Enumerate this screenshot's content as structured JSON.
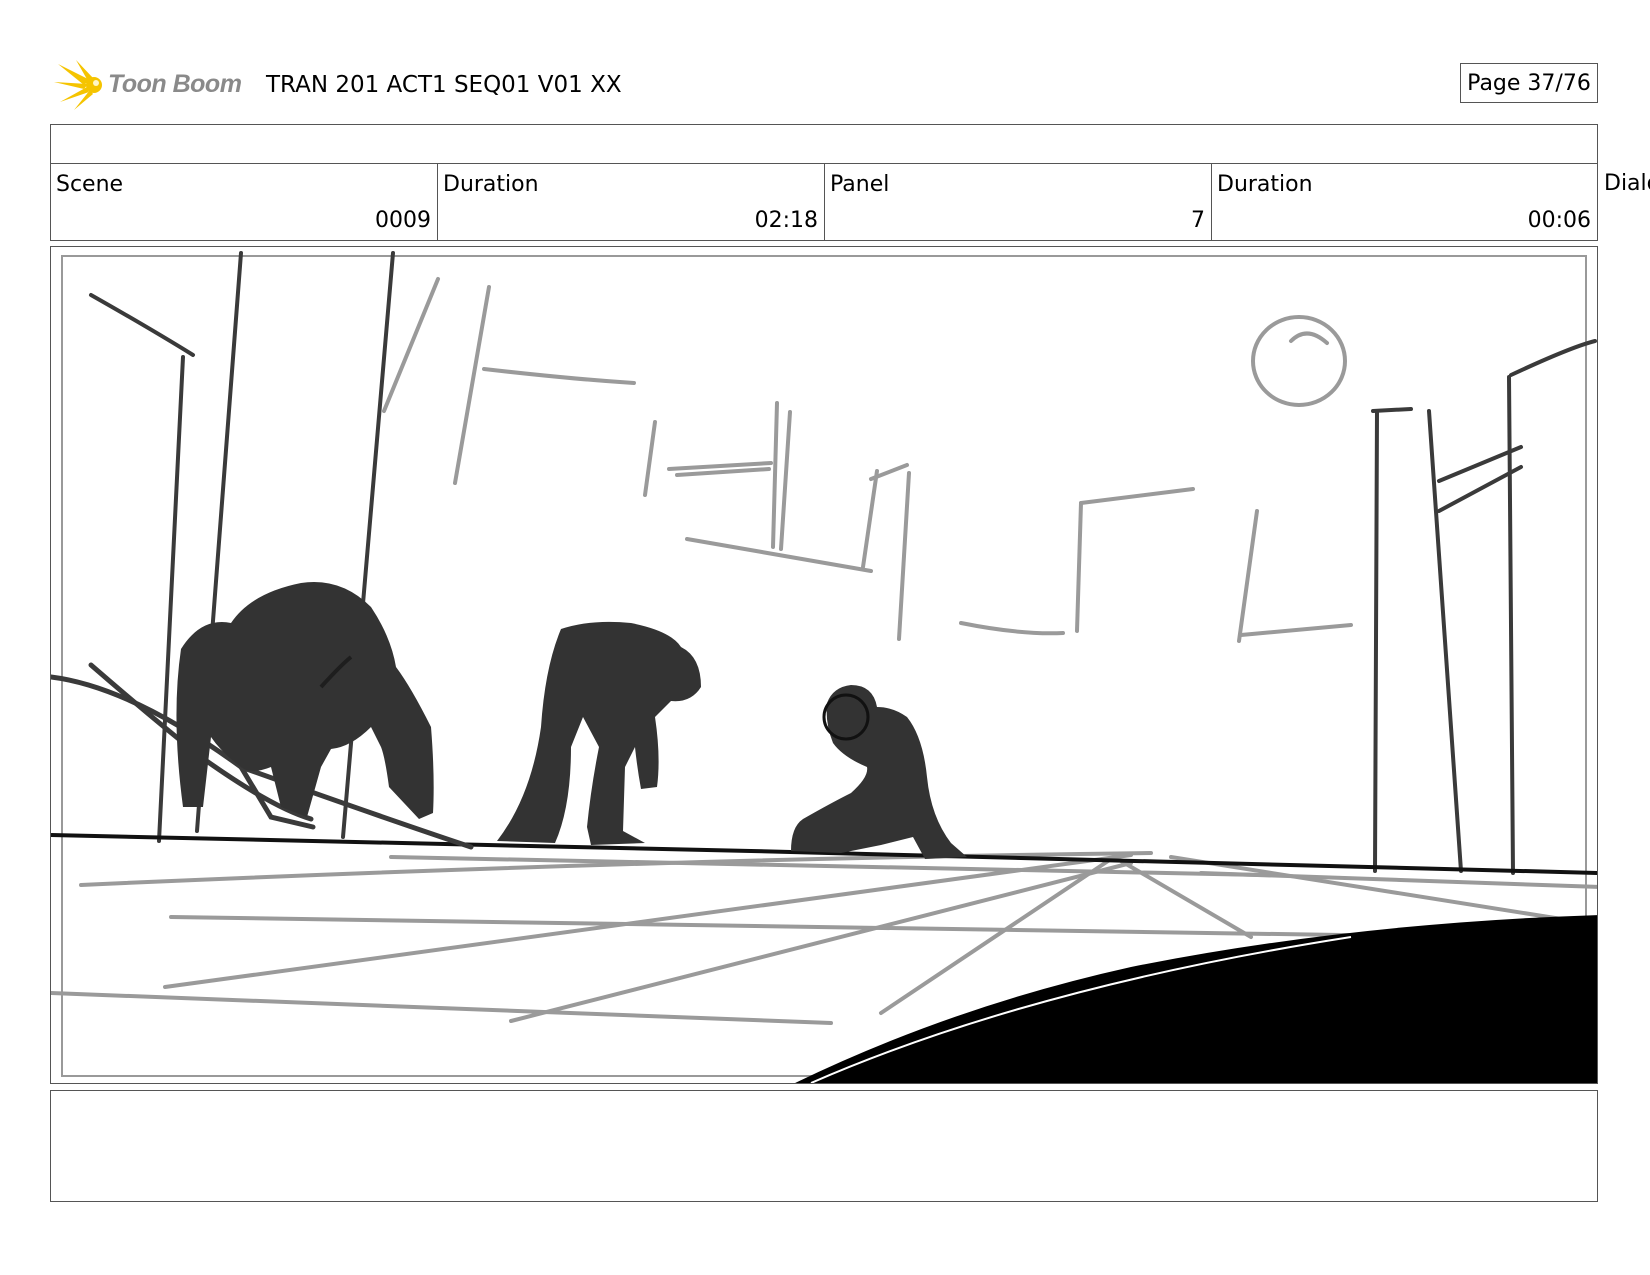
{
  "header": {
    "logo_text": "Toon Boom",
    "title": "TRAN 201 ACT1 SEQ01 V01 XX",
    "page": "Page 37/76"
  },
  "fields": {
    "scene_label": "Scene",
    "scene_value": "0009",
    "scene_duration_label": "Duration",
    "scene_duration_value": "02:18",
    "panel_label": "Panel",
    "panel_value": "7",
    "panel_duration_label": "Duration",
    "panel_duration_value": "00:06",
    "dialog_label": "Dialog"
  },
  "panel_image": {
    "icon": "storyboard-sketch-image"
  },
  "colors": {
    "logo_yellow": "#f5c400",
    "logo_text_gray": "#8a8a8a",
    "sketch_dark": "#2f2f2f",
    "sketch_gray": "#9a9a9a",
    "border": "#555555"
  }
}
